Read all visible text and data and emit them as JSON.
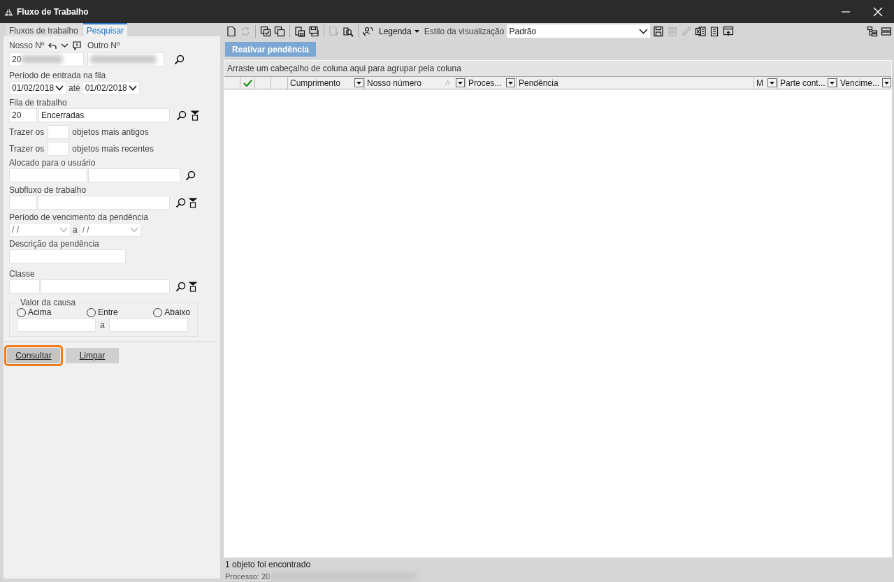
{
  "window": {
    "title": "Fluxo de Trabalho"
  },
  "side_tabs": [
    {
      "label": "Fluxos de trabalho",
      "selected": false
    },
    {
      "label": "Pesquisar",
      "selected": true
    }
  ],
  "search_form": {
    "nosso_numero": {
      "label": "Nosso Nº",
      "value": "20"
    },
    "outro_numero": {
      "label": "Outro Nº"
    },
    "periodo_entrada": {
      "label": "Período de entrada na fila",
      "from": "01/02/2018",
      "separator": "até",
      "to": "01/02/2018"
    },
    "fila": {
      "label": "Fila de trabalho",
      "code": "20",
      "name": "Encerradas"
    },
    "mais_antigos": {
      "prefix": "Trazer os",
      "suffix": "objetos mais antigos"
    },
    "mais_recentes": {
      "prefix": "Trazer os",
      "suffix": "objetos mais recentes"
    },
    "alocado": {
      "label": "Alocado para o usuário"
    },
    "subfluxo": {
      "label": "Subfluxo de trabalho"
    },
    "periodo_vencimento": {
      "label": "Período de vencimento da pendência",
      "from": "/ /",
      "separator": "a",
      "to": "/ /"
    },
    "descricao": {
      "label": "Descrição da pendência"
    },
    "classe": {
      "label": "Classe"
    },
    "valor_causa": {
      "legend": "Valor da causa",
      "separator": "a",
      "options": [
        {
          "label": "Acima",
          "selected": false
        },
        {
          "label": "Entre",
          "selected": false
        },
        {
          "label": "Abaixo",
          "selected": false
        }
      ]
    }
  },
  "buttons": [
    {
      "label": "Consultar",
      "focused": true
    },
    {
      "label": "Limpar",
      "focused": false
    }
  ],
  "toolbar": {
    "groups": [
      {
        "tools": [
          {
            "disabled": false
          },
          {
            "disabled": true
          }
        ]
      },
      {
        "tools": [
          {
            "disabled": false
          },
          {
            "disabled": false
          }
        ]
      },
      {
        "tools": [
          {
            "disabled": false
          },
          {
            "disabled": false
          }
        ]
      },
      {
        "tools": [
          {
            "disabled": true
          },
          {
            "disabled": false
          }
        ]
      },
      {
        "tools": [
          {
            "disabled": false
          }
        ]
      }
    ],
    "legend_menu": "Legenda",
    "view_style": {
      "label": "Estilo da visualização",
      "value": "Padrão"
    },
    "after_tools": [
      {
        "disabled": false
      },
      {
        "disabled": true
      },
      {
        "disabled": true
      },
      {
        "disabled": false
      },
      {
        "disabled": false
      },
      {
        "disabled": false
      }
    ],
    "right_tools": [
      {
        "disabled": false
      },
      {
        "disabled": false
      }
    ]
  },
  "action_button": "Reativar pendência",
  "grid": {
    "group_hint": "Arraste um cabeçalho de coluna aqui para agrupar pela coluna",
    "columns": [
      {
        "kind": "blank"
      },
      {
        "kind": "check"
      },
      {
        "kind": "blank"
      },
      {
        "kind": "blank"
      },
      {
        "kind": "text",
        "label": "Cumprimento",
        "filter": true,
        "sorted": false
      },
      {
        "kind": "text",
        "label": "Nosso número",
        "filter": true,
        "sorted": true
      },
      {
        "kind": "text",
        "label": "Proces...",
        "filter": true,
        "sorted": false
      },
      {
        "kind": "text",
        "label": "Pendência",
        "filter": false,
        "sorted": false
      },
      {
        "kind": "text",
        "label": "M",
        "filter": true,
        "sorted": false
      },
      {
        "kind": "text",
        "label": "Parte cont...",
        "filter": true,
        "sorted": false
      },
      {
        "kind": "text",
        "label": "Vencime...",
        "filter": true,
        "sorted": false
      }
    ]
  },
  "status": {
    "message": "1 objeto foi encontrado",
    "process_label": "Processo: 20"
  }
}
